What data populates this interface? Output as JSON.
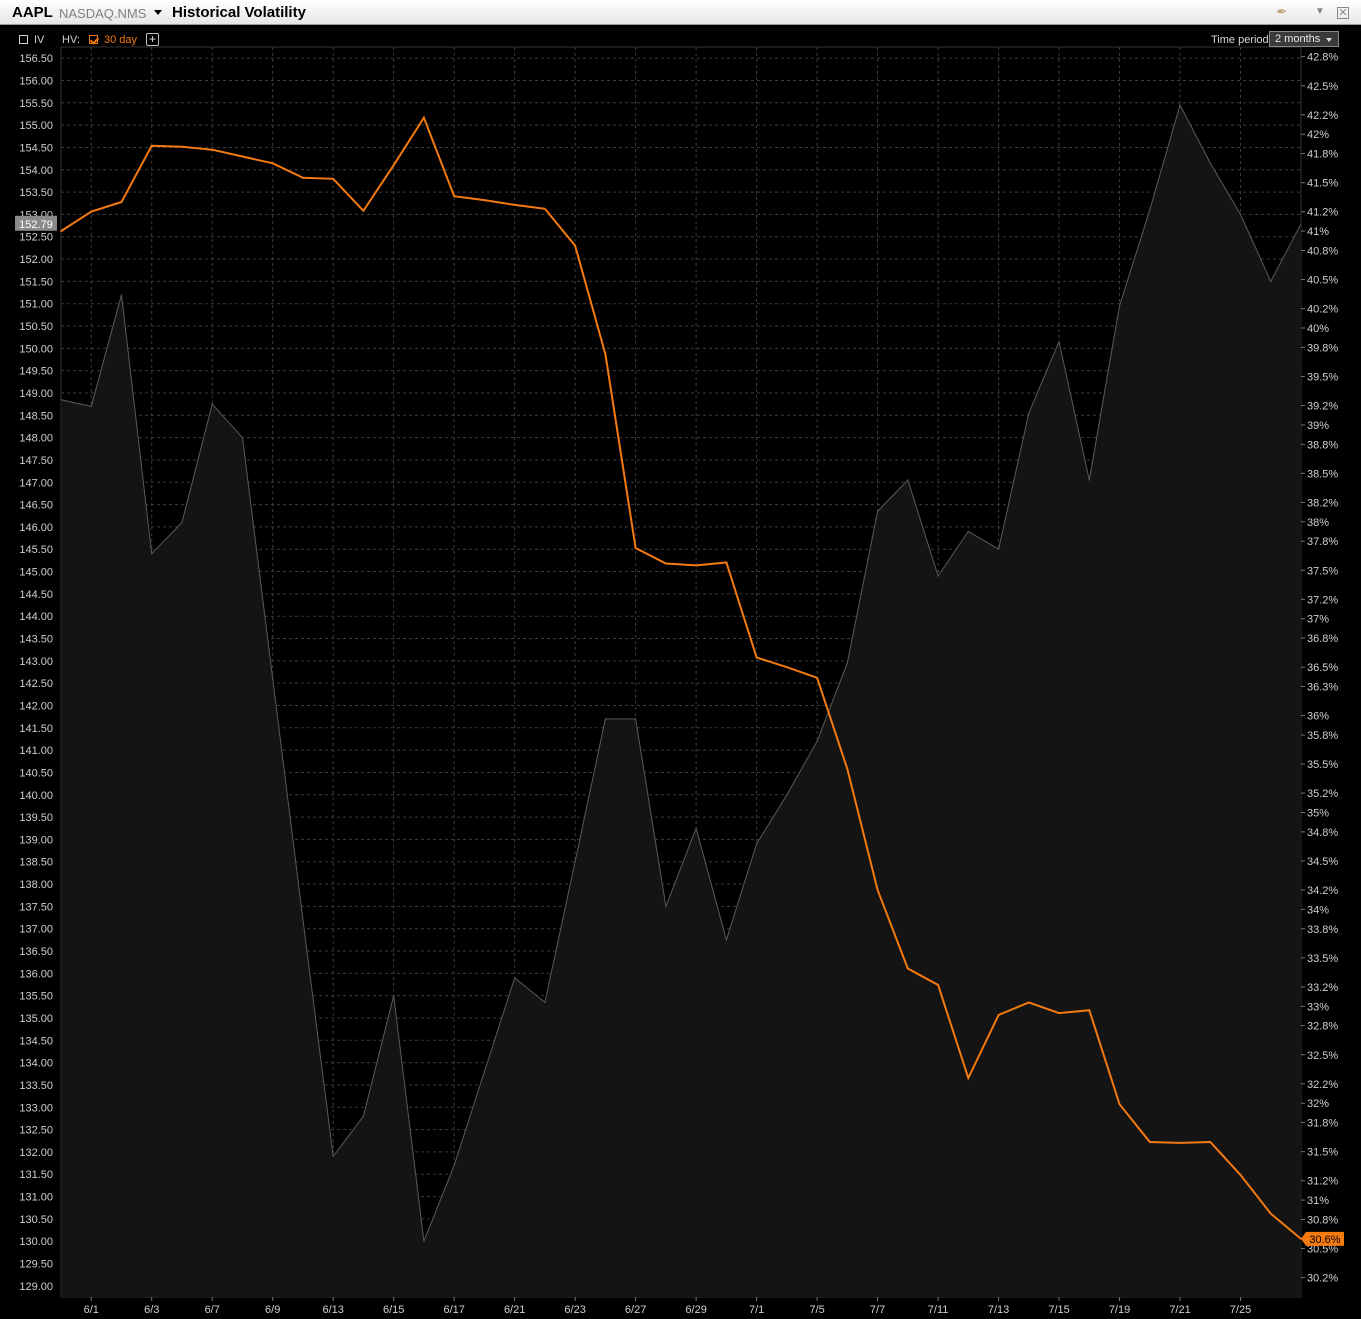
{
  "header": {
    "symbol": "AAPL",
    "exchange": "NASDAQ.NMS",
    "title": "Historical Volatility"
  },
  "controls": {
    "iv_label": "IV",
    "iv_checked": false,
    "hv_label": "HV:",
    "hv_period_label": "30 day",
    "hv_checked": true,
    "add_label": "+",
    "time_period_label": "Time period:",
    "time_period_value": "2 months"
  },
  "colors": {
    "hv_line": "#f47a10",
    "price_line": "#5a5a5a",
    "price_fill": "#141414",
    "grid": "#3c3c3c",
    "axis_text": "#cfcfcf"
  },
  "chart_data": {
    "type": "line",
    "x_tick_labels": [
      "6/1",
      "6/3",
      "6/7",
      "6/9",
      "6/13",
      "6/15",
      "6/17",
      "6/21",
      "6/23",
      "6/27",
      "6/29",
      "7/1",
      "7/5",
      "7/7",
      "7/11",
      "7/13",
      "7/15",
      "7/19",
      "7/21",
      "7/25"
    ],
    "left_axis": {
      "ylim": [
        128.75,
        156.75
      ],
      "tick_labels": [
        "156.50",
        "156.00",
        "155.50",
        "155.00",
        "154.50",
        "154.00",
        "153.50",
        "153.00",
        "152.50",
        "152.00",
        "151.50",
        "151.00",
        "150.50",
        "150.00",
        "149.50",
        "149.00",
        "148.50",
        "148.00",
        "147.50",
        "147.00",
        "146.50",
        "146.00",
        "145.50",
        "145.00",
        "144.50",
        "144.00",
        "143.50",
        "143.00",
        "142.50",
        "142.00",
        "141.50",
        "141.00",
        "140.50",
        "140.00",
        "139.50",
        "139.00",
        "138.50",
        "138.00",
        "137.50",
        "137.00",
        "136.50",
        "136.00",
        "135.50",
        "135.00",
        "134.50",
        "134.00",
        "133.50",
        "133.00",
        "132.50",
        "132.00",
        "131.50",
        "131.00",
        "130.50",
        "130.00",
        "129.50",
        "129.00"
      ],
      "last_value_label": "152.79"
    },
    "right_axis": {
      "ylim": [
        30.0,
        42.9
      ],
      "tick_labels": [
        "42.8%",
        "42.5%",
        "42.2%",
        "42%",
        "41.8%",
        "41.5%",
        "41.2%",
        "41%",
        "40.8%",
        "40.5%",
        "40.2%",
        "40%",
        "39.8%",
        "39.5%",
        "39.2%",
        "39%",
        "38.8%",
        "38.5%",
        "38.2%",
        "38%",
        "37.8%",
        "37.5%",
        "37.2%",
        "37%",
        "36.8%",
        "36.5%",
        "36.3%",
        "36%",
        "35.8%",
        "35.5%",
        "35.2%",
        "35%",
        "34.8%",
        "34.5%",
        "34.2%",
        "34%",
        "33.8%",
        "33.5%",
        "33.2%",
        "33%",
        "32.8%",
        "32.5%",
        "32.2%",
        "32%",
        "31.8%",
        "31.5%",
        "31.2%",
        "31%",
        "30.8%",
        "30.5%",
        "30.2%"
      ],
      "last_value_label": "30.6%"
    },
    "series": [
      {
        "name": "HV 30 day",
        "axis": "right",
        "values": [
          41.0,
          41.2,
          41.3,
          41.88,
          41.87,
          41.84,
          41.77,
          41.7,
          41.55,
          41.54,
          41.21,
          41.68,
          42.17,
          41.36,
          41.32,
          41.27,
          41.23,
          40.85,
          39.73,
          37.73,
          37.57,
          37.55,
          37.58,
          36.6,
          36.5,
          36.39,
          35.45,
          34.2,
          33.39,
          33.22,
          32.26,
          32.91,
          33.04,
          32.93,
          32.96,
          31.99,
          31.6,
          31.59,
          31.6,
          31.26,
          30.86,
          30.6
        ]
      },
      {
        "name": "AAPL price",
        "axis": "left",
        "values": [
          148.85,
          148.7,
          151.2,
          145.4,
          146.1,
          148.75,
          148.0,
          142.6,
          137.2,
          131.9,
          132.8,
          135.5,
          130.0,
          131.7,
          133.8,
          135.9,
          135.35,
          138.5,
          141.7,
          141.7,
          137.5,
          139.25,
          136.75,
          138.9,
          140.0,
          141.2,
          142.95,
          146.35,
          147.05,
          144.9,
          145.9,
          145.5,
          148.55,
          150.15,
          147.05,
          150.95,
          153.1,
          155.45,
          154.15,
          153.0,
          151.5,
          152.79
        ]
      }
    ]
  }
}
